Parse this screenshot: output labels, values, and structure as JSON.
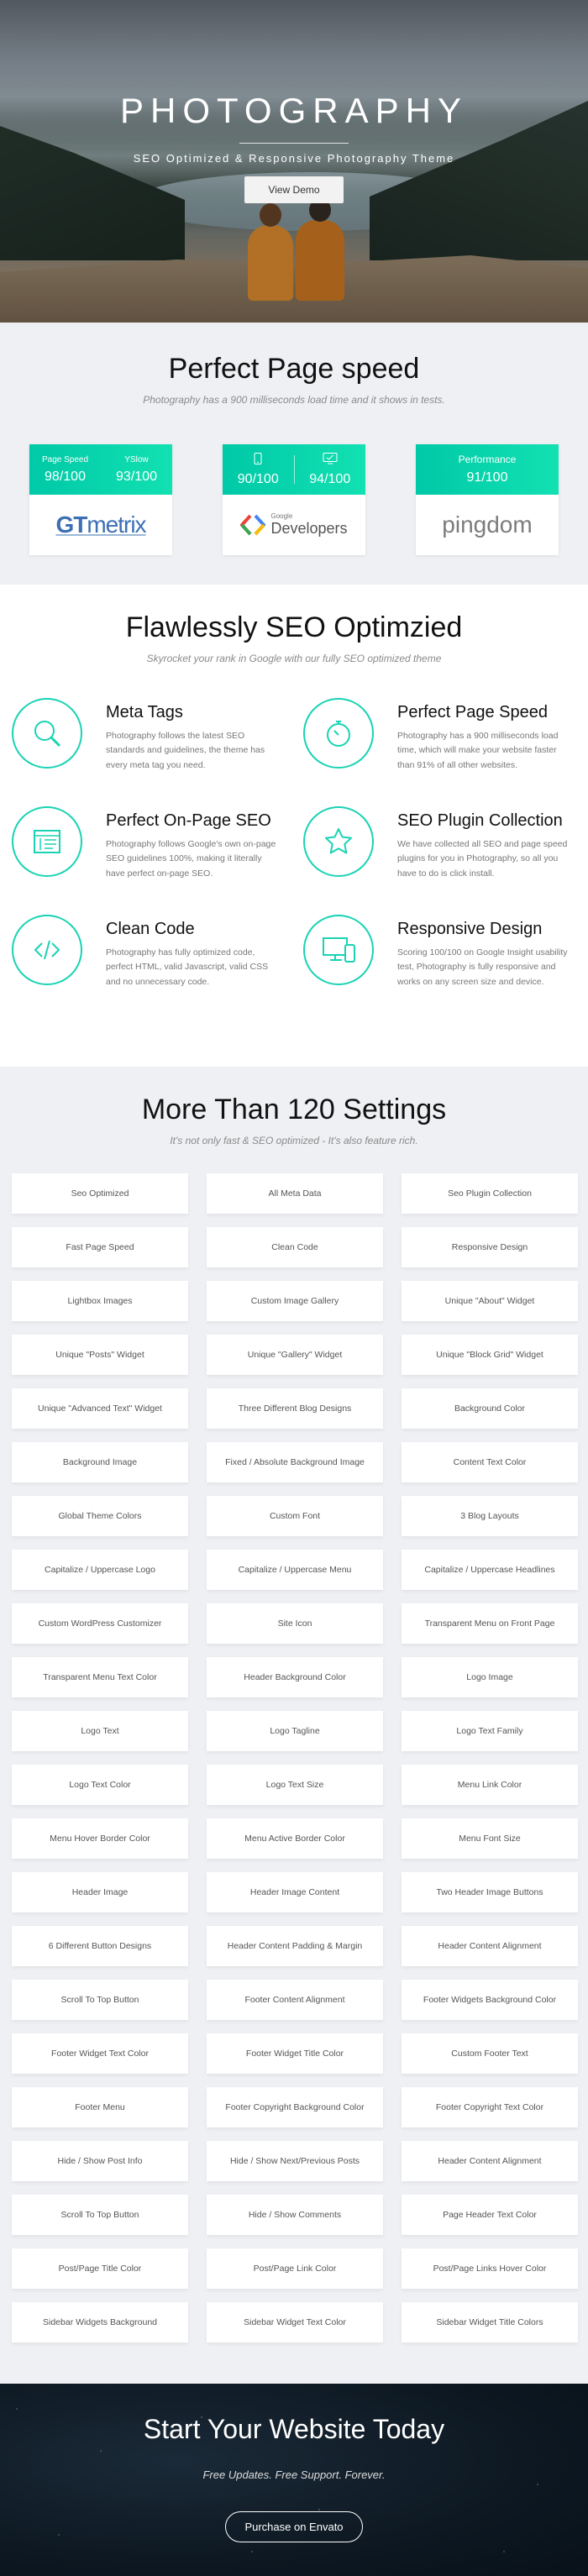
{
  "hero": {
    "title": "PHOTOGRAPHY",
    "subtitle": "SEO Optimized & Responsive Photography Theme",
    "button": "View Demo"
  },
  "speed": {
    "title": "Perfect Page speed",
    "subtitle": "Photography has a 900 milliseconds load time and it shows in tests.",
    "gtmetrix": {
      "label1": "Page Speed",
      "value1": "98/100",
      "label2": "YSlow",
      "value2": "93/100",
      "logo_bold": "GT",
      "logo_rest": "metrix"
    },
    "google": {
      "value1": "90/100",
      "value2": "94/100",
      "logo_small": "Google",
      "logo_text": "Developers",
      "icon1": "mobile-icon",
      "icon2": "desktop-icon"
    },
    "pingdom": {
      "label": "Performance",
      "value": "91/100",
      "logo": "pingdom"
    }
  },
  "seo": {
    "title": "Flawlessly SEO Optimzied",
    "subtitle": "Skyrocket your rank in Google with our fully SEO optimized theme",
    "features": [
      {
        "title": "Meta Tags",
        "text": "Photography follows the latest SEO standards and guidelines, the theme has every meta tag you need.",
        "icon": "search-icon"
      },
      {
        "title": "Perfect Page Speed",
        "text": "Photography has a 900 milliseconds load time, which will make your website faster than 91% of all other websites.",
        "icon": "stopwatch-icon"
      },
      {
        "title": "Perfect On-Page SEO",
        "text": "Photography follows Google's own on-page SEO guidelines 100%, making it literally have perfect on-page SEO.",
        "icon": "browser-layout-icon"
      },
      {
        "title": "SEO Plugin Collection",
        "text": "We have collected all SEO and page speed plugins for you in Photography, so all you have to do is click install.",
        "icon": "star-icon"
      },
      {
        "title": "Clean Code",
        "text": "Photography has fully optimized code, perfect HTML, valid Javascript, valid CSS and no unnecessary code.",
        "icon": "code-icon"
      },
      {
        "title": "Responsive Design",
        "text": "Scoring 100/100 on Google Insight usability test, Photography is fully responsive and works on any screen size and device.",
        "icon": "devices-icon"
      }
    ]
  },
  "settings": {
    "title": "More Than 120 Settings",
    "subtitle": "It's not only fast & SEO optimized - It's also feature rich.",
    "items": [
      "Seo Optimized",
      "All Meta Data",
      "Seo Plugin Collection",
      "Fast Page Speed",
      "Clean Code",
      "Responsive Design",
      "Lightbox Images",
      "Custom Image Gallery",
      "Unique \"About\" Widget",
      "Unique \"Posts\" Widget",
      "Unique \"Gallery\" Widget",
      "Unique \"Block Grid\" Widget",
      "Unique \"Advanced Text\" Widget",
      "Three Different Blog Designs",
      "Background Color",
      "Background Image",
      "Fixed / Absolute Background Image",
      "Content Text Color",
      "Global Theme Colors",
      "Custom Font",
      "3 Blog Layouts",
      "Capitalize / Uppercase Logo",
      "Capitalize / Uppercase Menu",
      "Capitalize / Uppercase Headlines",
      "Custom WordPress Customizer",
      "Site Icon",
      "Transparent Menu on Front Page",
      "Transparent Menu Text Color",
      "Header Background Color",
      "Logo Image",
      "Logo Text",
      "Logo Tagline",
      "Logo Text Family",
      "Logo Text Color",
      "Logo Text Size",
      "Menu Link Color",
      "Menu Hover Border Color",
      "Menu Active Border Color",
      "Menu Font Size",
      "Header Image",
      "Header Image Content",
      "Two Header Image Buttons",
      "6 Different Button Designs",
      "Header Content Padding & Margin",
      "Header Content Alignment",
      "Scroll To Top Button",
      "Footer Content Alignment",
      "Footer Widgets Background Color",
      "Footer Widget Text Color",
      "Footer Widget Title Color",
      "Custom Footer Text",
      "Footer Menu",
      "Footer Copyright Background Color",
      "Footer Copyright Text Color",
      "Hide / Show Post Info",
      "Hide / Show Next/Previous Posts",
      "Header Content Alignment",
      "Scroll To Top Button",
      "Hide / Show Comments",
      "Page Header Text Color",
      "Post/Page Title Color",
      "Post/Page Link Color",
      "Post/Page Links Hover Color",
      "Sidebar Widgets Background",
      "Sidebar Widget Text Color",
      "Sidebar Widget Title Colors"
    ]
  },
  "cta": {
    "title": "Start Your Website Today",
    "subtitle": "Free Updates. Free Support. Forever.",
    "button": "Purchase on Envato"
  },
  "colors": {
    "accent": "#19d3b4",
    "bg_light": "#eef0f3",
    "dark": "#0d1822"
  }
}
